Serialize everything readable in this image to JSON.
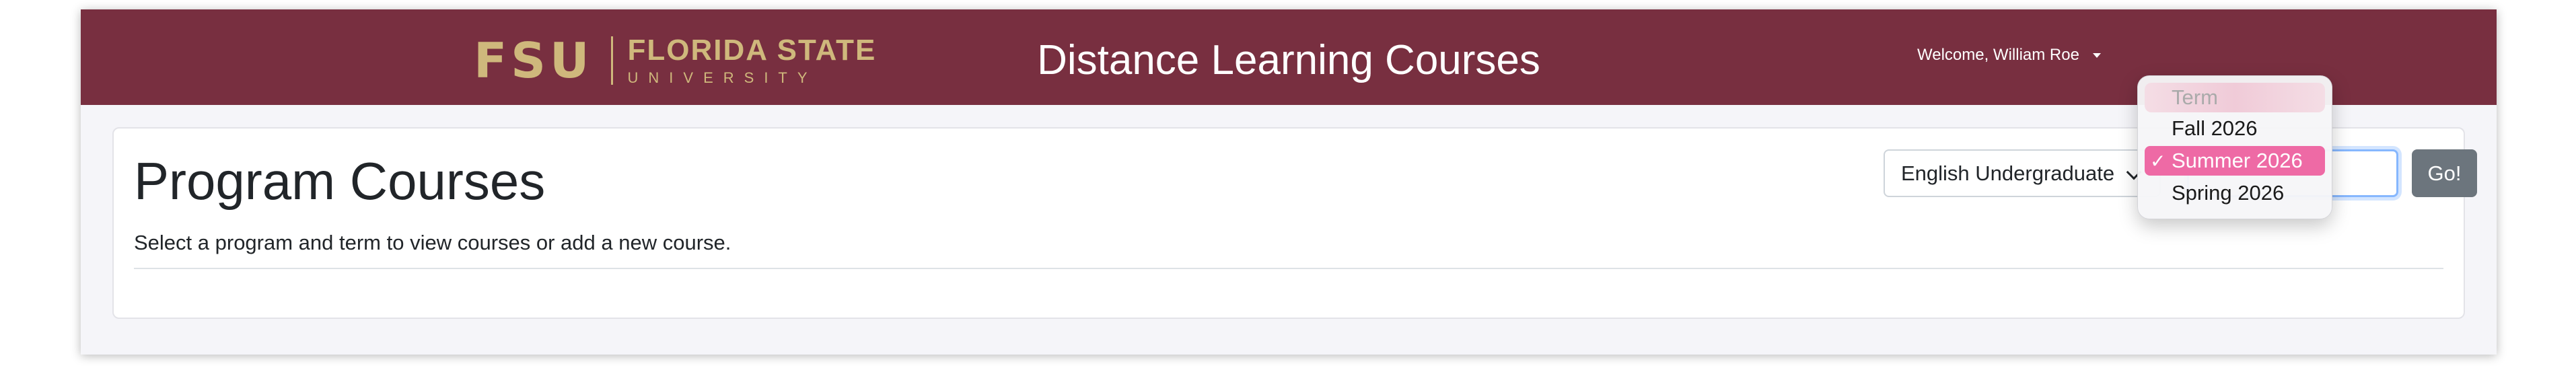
{
  "navbar": {
    "logo_mark": "FSU",
    "logo_name": "FLORIDA STATE",
    "logo_sub": "UNIVERSITY",
    "title": "Distance Learning Courses",
    "user_menu_label": "Welcome, William Roe",
    "background": "#782f40",
    "logo_color": "#cfb87c"
  },
  "card": {
    "title": "Program Courses",
    "subtitle": "Select a program and term to view courses or add a new course."
  },
  "filters": {
    "program_selected": "English Undergraduate",
    "go_label": "Go!",
    "term_placeholder": "Term",
    "term_options": [
      "Fall 2026",
      "Summer 2026",
      "Spring 2026"
    ],
    "term_selected": "Summer 2026",
    "selected_mark": "✓",
    "selected_color": "#ee6aa5"
  }
}
